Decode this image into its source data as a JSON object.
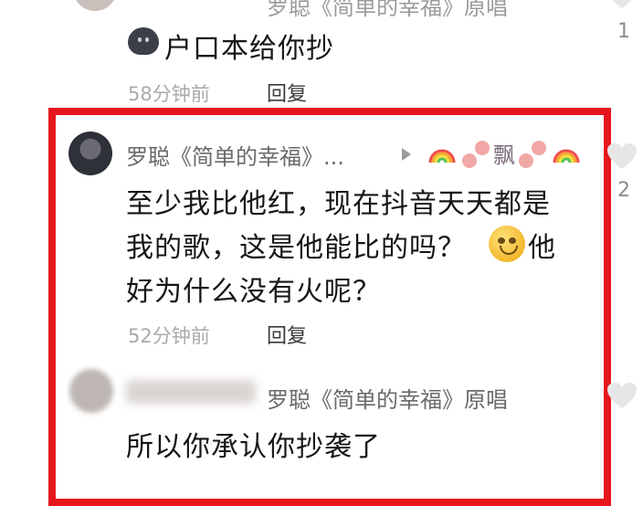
{
  "top_comment": {
    "author": "罗聪《简单的幸福》原唱",
    "like_count": "1"
  },
  "comment1": {
    "text": "户口本给你抄",
    "time": "58分钟前",
    "reply_label": "回复"
  },
  "comment2": {
    "author": "罗聪《简单的幸福》...",
    "deco_char": "飘",
    "text_lines": [
      "至少我比他红，现在抖音天天都是",
      "我的歌，这是他能比的吗？",
      "他",
      "好为什么没有火呢？"
    ],
    "time": "52分钟前",
    "reply_label": "回复",
    "like_count": "2"
  },
  "comment3": {
    "author": "罗聪《简单的幸福》原唱",
    "text": "所以你承认你抄袭了"
  },
  "colors": {
    "highlight_border": "#e5171d",
    "time_gray": "#aaaaaa"
  },
  "icons": [
    "heart-icon",
    "play-triangle-icon",
    "rainbow-emoji",
    "paw-emoji",
    "smile-emoji"
  ]
}
